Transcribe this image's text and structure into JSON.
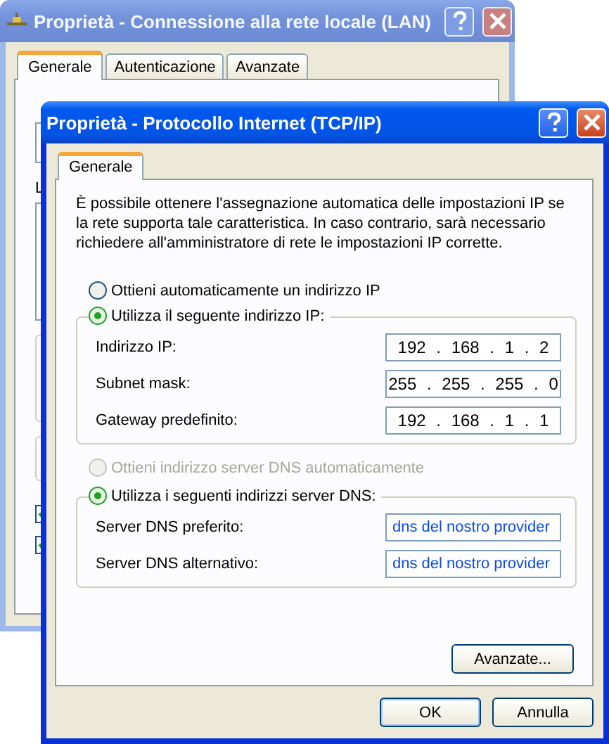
{
  "back_window": {
    "title": "Proprietà - Connessione alla rete locale (LAN)",
    "active": false,
    "tabs": [
      {
        "label": "Generale",
        "selected": true
      },
      {
        "label": "Autenticazione",
        "selected": false
      },
      {
        "label": "Avanzate",
        "selected": false
      }
    ],
    "labels": [
      "L"
    ],
    "checkboxes": [
      {
        "checked": true
      },
      {
        "checked": true
      }
    ]
  },
  "front_window": {
    "title": "Proprietà - Protocollo Internet (TCP/IP)",
    "active": true,
    "tabs": [
      {
        "label": "Generale",
        "selected": true
      }
    ],
    "intro": "È possibile ottenere l'assegnazione automatica delle impostazioni IP se la rete supporta tale caratteristica. In caso contrario, sarà necessario richiedere all'amministratore di rete le impostazioni IP corrette.",
    "ip_options": [
      {
        "label": "Ottieni automaticamente un indirizzo IP",
        "selected": false,
        "disabled": false,
        "kind": "plain"
      },
      {
        "label": "Utilizza il seguente indirizzo IP:",
        "selected": true,
        "disabled": false,
        "kind": "group"
      }
    ],
    "ip_fields": [
      {
        "label": "Indirizzo IP:",
        "value": "192 . 168 . 1 . 2"
      },
      {
        "label": "Subnet mask:",
        "value": "255 . 255 . 255 . 0"
      },
      {
        "label": "Gateway predefinito:",
        "value": "192 . 168 . 1 . 1"
      }
    ],
    "dns_options": [
      {
        "label": "Ottieni indirizzo server DNS automaticamente",
        "selected": false,
        "disabled": true,
        "kind": "plain"
      },
      {
        "label": "Utilizza i seguenti indirizzi server DNS:",
        "selected": true,
        "disabled": false,
        "kind": "group"
      }
    ],
    "dns_fields": [
      {
        "label": "Server DNS preferito:",
        "value": "dns del nostro provider"
      },
      {
        "label": "Server DNS alternativo:",
        "value": "dns del nostro provider"
      }
    ],
    "advanced_button": "Avanzate...",
    "buttons": [
      "OK",
      "Annulla"
    ]
  }
}
